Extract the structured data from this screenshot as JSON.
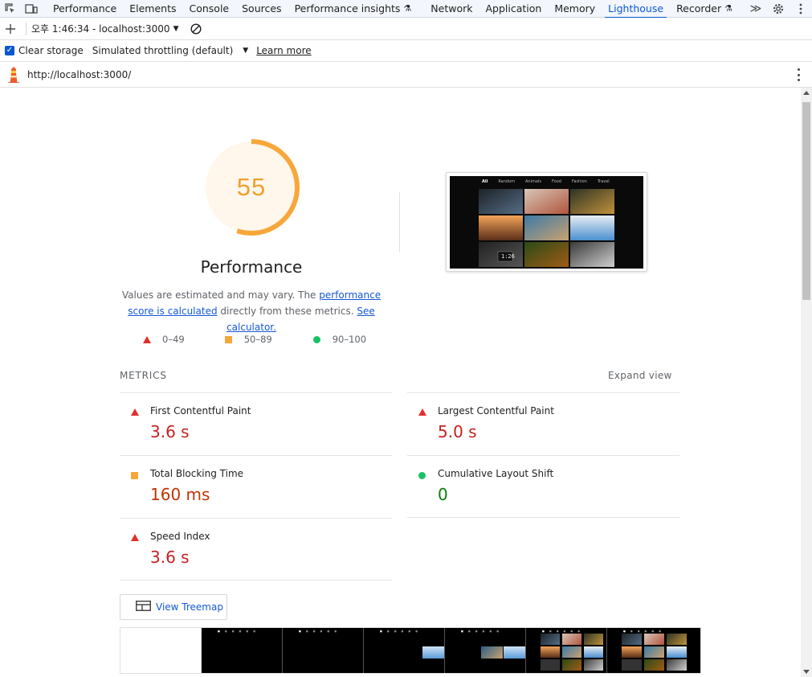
{
  "devtools": {
    "tabs": [
      {
        "label": "Performance",
        "flask": false
      },
      {
        "label": "Elements",
        "flask": false
      },
      {
        "label": "Console",
        "flask": false
      },
      {
        "label": "Sources",
        "flask": false
      },
      {
        "label": "Performance insights",
        "flask": true
      },
      {
        "label": "Network",
        "flask": false
      },
      {
        "label": "Application",
        "flask": false
      },
      {
        "label": "Memory",
        "flask": false
      },
      {
        "label": "Lighthouse",
        "flask": false,
        "active": true
      },
      {
        "label": "Recorder",
        "flask": true
      }
    ],
    "overflow_label": "≫"
  },
  "toolbar": {
    "report_label": "오후 1:46:34 - localhost:3000"
  },
  "options": {
    "clear_storage_label": "Clear storage",
    "clear_storage_checked": true,
    "throttling_label": "Simulated throttling (default)",
    "learn_more_label": "Learn more"
  },
  "url": {
    "text": "http://localhost:3000/"
  },
  "report": {
    "score": "55",
    "score_fraction": 0.55,
    "score_color": "#f7a73a",
    "category_title": "Performance",
    "desc_prefix": "Values are estimated and may vary. The ",
    "desc_link1": "performance score is calculated",
    "desc_middle": " directly from these metrics. ",
    "desc_link2": "See calculator.",
    "legend": [
      {
        "range": "0–49",
        "shape": "triangle",
        "color": "#e0302c"
      },
      {
        "range": "50–89",
        "shape": "square",
        "color": "#f7a73a"
      },
      {
        "range": "90–100",
        "shape": "circle",
        "color": "#18c163"
      }
    ],
    "metrics_heading": "METRICS",
    "expand_view_label": "Expand view",
    "metrics": [
      {
        "label": "First Contentful Paint",
        "value": "3.6 s",
        "rating": "fail"
      },
      {
        "label": "Largest Contentful Paint",
        "value": "5.0 s",
        "rating": "fail"
      },
      {
        "label": "Total Blocking Time",
        "value": "160 ms",
        "rating": "average"
      },
      {
        "label": "Cumulative Layout Shift",
        "value": "0",
        "rating": "pass"
      },
      {
        "label": "Speed Index",
        "value": "3.6 s",
        "rating": "fail"
      }
    ],
    "treemap_label": "View Treemap",
    "screenshot_nav": [
      "All",
      "Random",
      "Animals",
      "Food",
      "Fashion",
      "Travel"
    ],
    "screenshot_clock": "1:26"
  }
}
